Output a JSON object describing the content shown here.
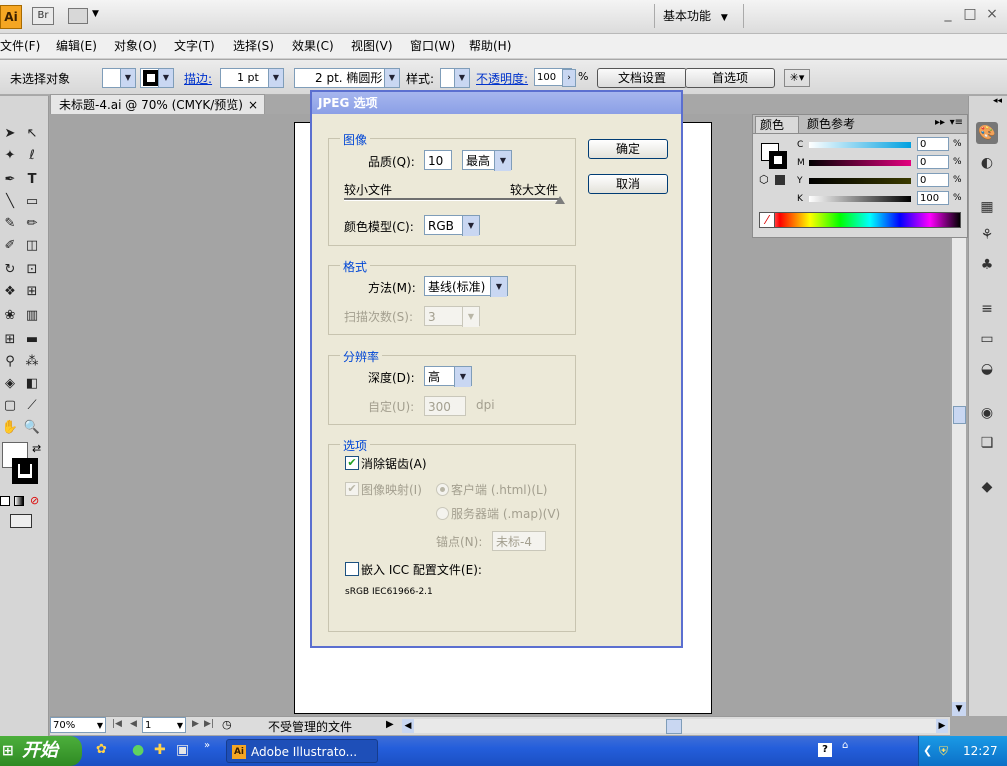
{
  "app": {
    "logo": "Ai",
    "bridge": "Br",
    "workspace": "基本功能",
    "window_min": "_",
    "window_max": "□",
    "window_close": "×"
  },
  "menu": [
    "文件(F)",
    "编辑(E)",
    "对象(O)",
    "文字(T)",
    "选择(S)",
    "效果(C)",
    "视图(V)",
    "窗口(W)",
    "帮助(H)"
  ],
  "control": {
    "no_selection": "未选择对象",
    "stroke_label": "描边:",
    "stroke_weight": "1 pt",
    "brush_label": "2 pt. 椭圆形",
    "style_label": "样式:",
    "opacity_label": "不透明度:",
    "opacity_value": "100",
    "opacity_unit": "%",
    "doc_setup_button": "文档设置",
    "preferences_button": "首选项"
  },
  "document": {
    "tab_title": "未标题-4.ai @ 70% (CMYK/预览)",
    "tab_close": "×"
  },
  "dialog": {
    "title": "JPEG 选项",
    "ok_button": "确定",
    "cancel_button": "取消",
    "image": {
      "group_title": "图像",
      "quality_label": "品质(Q):",
      "quality_value": "10",
      "quality_preset": "最高",
      "smaller_file": "较小文件",
      "larger_file": "较大文件",
      "quality_slider_fraction": 1.0,
      "color_model_label": "颜色模型(C):",
      "color_model_value": "RGB"
    },
    "format": {
      "group_title": "格式",
      "method_label": "方法(M):",
      "method_value": "基线(标准)",
      "scans_label": "扫描次数(S):",
      "scans_value": "3"
    },
    "resolution": {
      "group_title": "分辨率",
      "depth_label": "深度(D):",
      "depth_value": "高",
      "custom_label": "自定(U):",
      "custom_value": "300",
      "custom_unit": "dpi"
    },
    "options": {
      "group_title": "选项",
      "antialias_label": "消除锯齿(A)",
      "antialias_checked": true,
      "imagemap_label": "图像映射(I)",
      "client_label": "客户端 (.html)(L)",
      "server_label": "服务器端 (.map)(V)",
      "anchor_label": "锚点(N):",
      "anchor_value": "未标-4",
      "embed_icc_label": "嵌入 ICC 配置文件(E):",
      "icc_profile": "sRGB IEC61966-2.1"
    }
  },
  "color_panel": {
    "tab_color": "颜色",
    "tab_guide": "颜色参考",
    "channels": [
      {
        "name": "C",
        "value": "0",
        "unit": "%"
      },
      {
        "name": "M",
        "value": "0",
        "unit": "%"
      },
      {
        "name": "Y",
        "value": "0",
        "unit": "%"
      },
      {
        "name": "K",
        "value": "100",
        "unit": "%"
      }
    ]
  },
  "status": {
    "zoom": "70%",
    "page": "1",
    "profile_text": "不受管理的文件"
  },
  "taskbar": {
    "start": "开始",
    "app_button": "Adobe Illustrato...",
    "clock": "12:27"
  }
}
